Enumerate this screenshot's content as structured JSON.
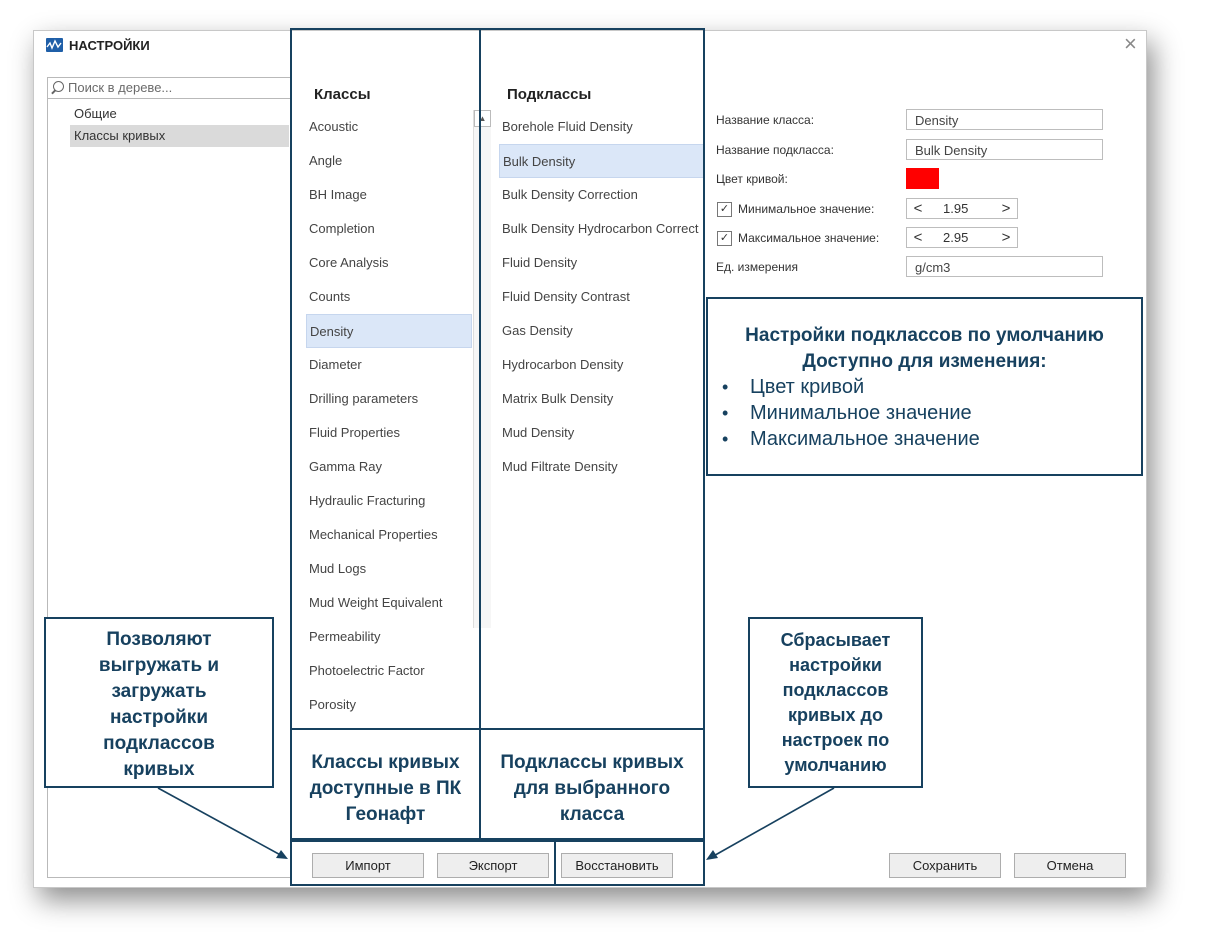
{
  "window": {
    "title": "НАСТРОЙКИ",
    "close_icon": "×"
  },
  "tree": {
    "search_placeholder": "Поиск в дереве...",
    "items": [
      {
        "label": "Общие",
        "selected": false
      },
      {
        "label": "Классы кривых",
        "selected": true
      }
    ]
  },
  "classes": {
    "header": "Классы",
    "items": [
      "Acoustic",
      "Angle",
      "BH Image",
      "Completion",
      "Core Analysis",
      "Counts",
      "Density",
      "Diameter",
      "Drilling parameters",
      "Fluid Properties",
      "Gamma Ray",
      "Hydraulic Fracturing",
      "Mechanical Properties",
      "Mud Logs",
      "Mud Weight Equivalent",
      "Permeability",
      "Photoelectric Factor",
      "Porosity"
    ],
    "selected": "Density"
  },
  "subclasses": {
    "header": "Подклассы",
    "items": [
      "Borehole Fluid Density",
      "Bulk Density",
      "Bulk Density Correction",
      "Bulk Density Hydrocarbon Correct",
      "Fluid Density",
      "Fluid Density Contrast",
      "Gas Density",
      "Hydrocarbon Density",
      "Matrix Bulk Density",
      "Mud Density",
      "Mud Filtrate Density"
    ],
    "selected": "Bulk Density"
  },
  "form": {
    "class_name_label": "Название класса:",
    "class_name_value": "Density",
    "subclass_name_label": "Название подкласса:",
    "subclass_name_value": "Bulk Density",
    "curve_color_label": "Цвет кривой:",
    "curve_color": "#ff0000",
    "min_label": "Минимальное значение:",
    "min_value": "1.95",
    "min_checked": true,
    "max_label": "Максимальное значение:",
    "max_value": "2.95",
    "max_checked": true,
    "units_label": "Ед. измерения",
    "units_value": "g/cm3"
  },
  "buttons": {
    "import": "Импорт",
    "export": "Экспорт",
    "restore": "Восстановить",
    "save": "Сохранить",
    "cancel": "Отмена"
  },
  "annotations": {
    "info_title_1": "Настройки подклассов по умолчанию",
    "info_title_2": "Доступно для изменения:",
    "info_items": [
      "Цвет кривой",
      "Минимальное значение",
      "Максимальное значение"
    ],
    "import_export_note": [
      "Позволяют",
      "выгружать и",
      "загружать",
      "настройки",
      "подклассов",
      "кривых"
    ],
    "restore_note": [
      "Сбрасывает",
      "настройки",
      "подклассов",
      "кривых до",
      "настроек по",
      "умолчанию"
    ],
    "classes_note": [
      "Классы кривых",
      "доступные в ПК",
      "Геонафт"
    ],
    "subclasses_note": [
      "Подклассы кривых",
      "для выбранного",
      "класса"
    ]
  },
  "colors": {
    "annotation": "#17415f",
    "selection": "#dbe7f8",
    "accent_icon": "#1f5fa8"
  }
}
